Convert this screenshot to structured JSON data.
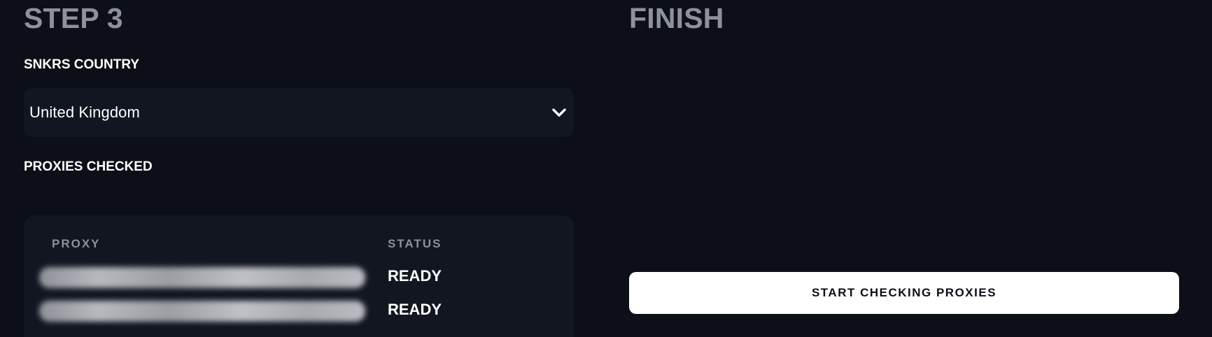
{
  "step3": {
    "title": "STEP 3",
    "country_label": "SNKRS COUNTRY",
    "country_selected": "United Kingdom",
    "proxies_label": "PROXIES CHECKED",
    "table": {
      "headers": {
        "proxy": "PROXY",
        "status": "STATUS"
      },
      "rows": [
        {
          "status": "READY"
        },
        {
          "status": "READY"
        }
      ]
    }
  },
  "finish": {
    "title": "FINISH",
    "start_button_label": "START CHECKING PROXIES"
  },
  "icons": {
    "dropdown": "chevron-down-icon"
  },
  "colors": {
    "background": "#0c0f17",
    "panel": "#121620",
    "muted_text": "#8e909b",
    "button": "#ffffff"
  }
}
